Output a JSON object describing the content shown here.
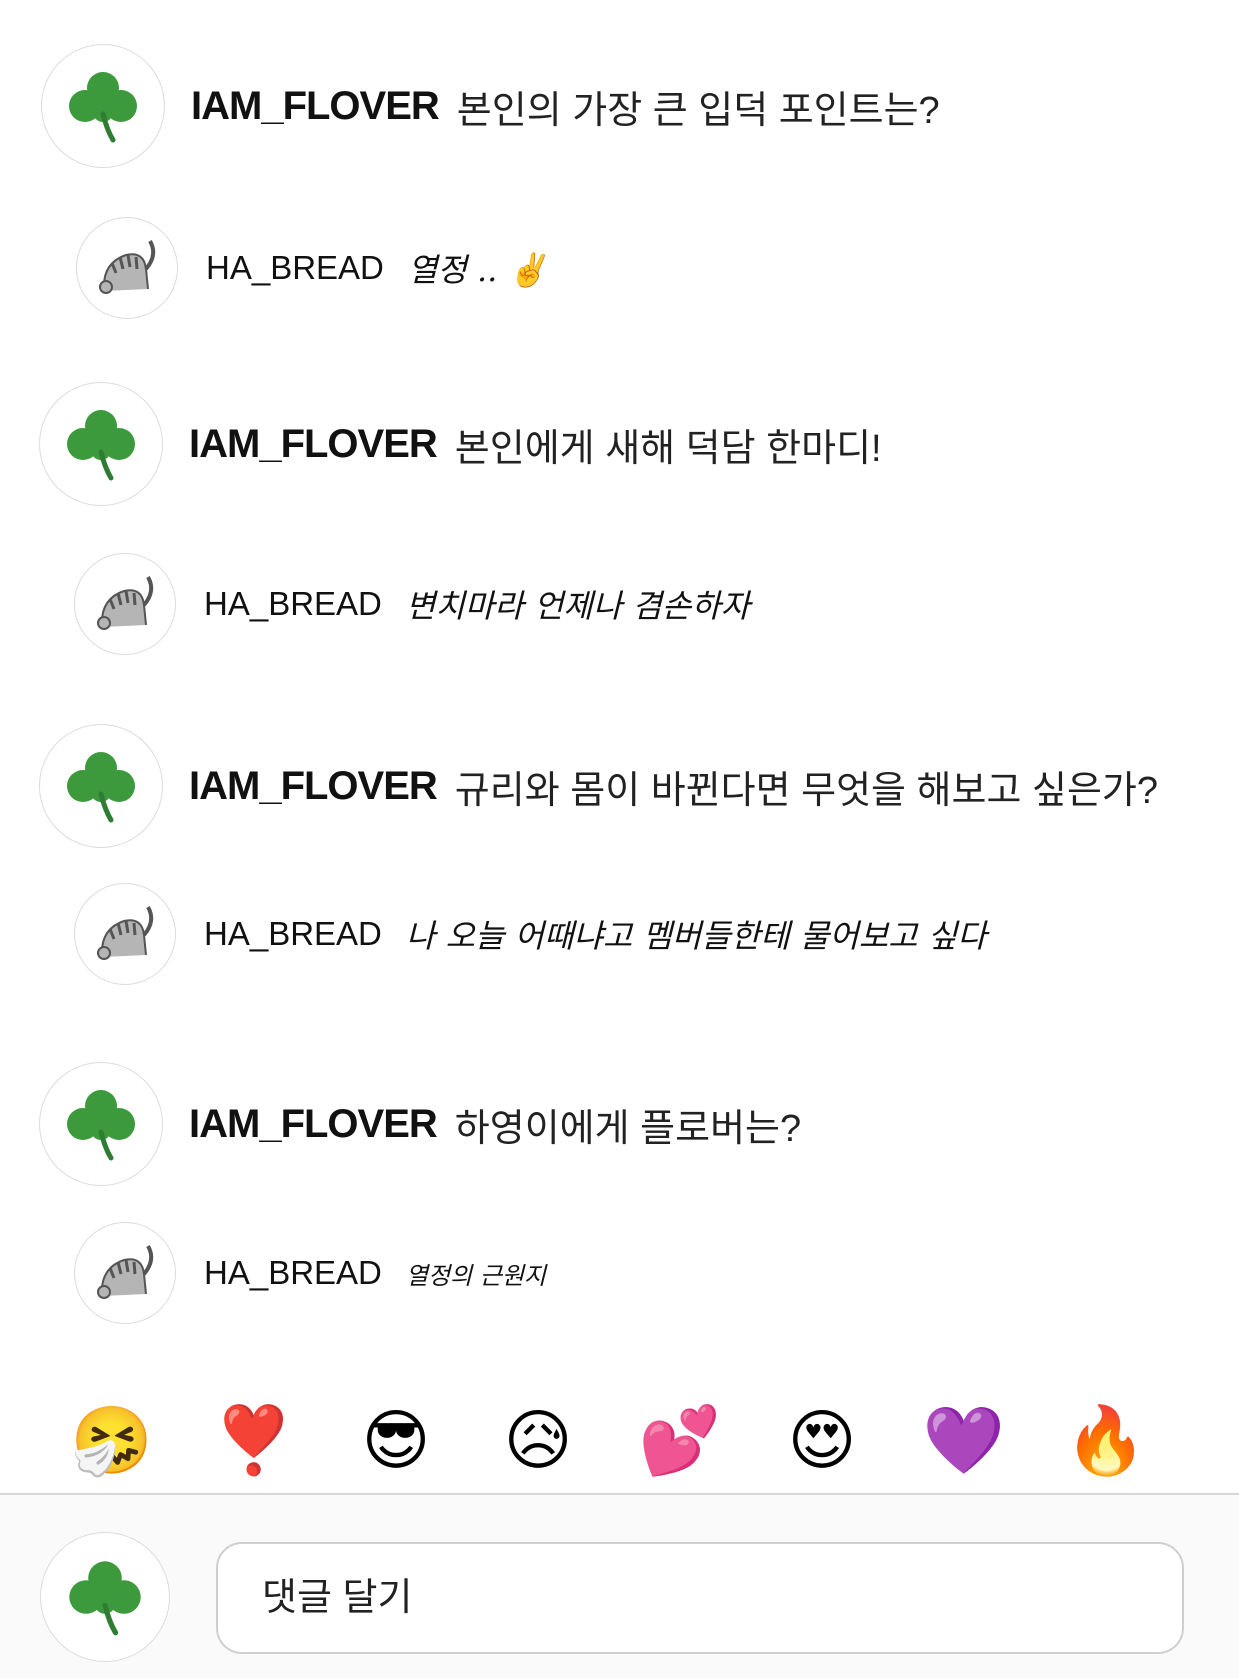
{
  "thread": [
    {
      "kind": "question",
      "username": "IAM_FLOVER",
      "text": "본인의 가장 큰 입덕 포인트는?",
      "avatar": "clover-icon"
    },
    {
      "kind": "answer",
      "username": "HA_BREAD",
      "text": "열정 .. ✌",
      "avatar": "cat-icon"
    },
    {
      "kind": "question",
      "username": "IAM_FLOVER",
      "text": "본인에게 새해 덕담 한마디!",
      "avatar": "clover-icon"
    },
    {
      "kind": "answer",
      "username": "HA_BREAD",
      "text": "변치마라 언제나 겸손하자",
      "avatar": "cat-icon"
    },
    {
      "kind": "question",
      "username": "IAM_FLOVER",
      "text": "규리와 몸이 바뀐다면 무엇을 해보고 싶은가?",
      "avatar": "clover-icon"
    },
    {
      "kind": "answer",
      "username": "HA_BREAD",
      "text": "나 오늘 어때냐고 멤버들한테 물어보고 싶다",
      "avatar": "cat-icon"
    },
    {
      "kind": "question",
      "username": "IAM_FLOVER",
      "text": "하영이에게 플로버는?",
      "avatar": "clover-icon"
    },
    {
      "kind": "answer",
      "username": "HA_BREAD",
      "text": "열정의 근원지",
      "avatar": "cat-icon"
    }
  ],
  "reactions": [
    {
      "name": "sneezing-face",
      "glyph": "🤧"
    },
    {
      "name": "heart-exclamation",
      "glyph": "❣️"
    },
    {
      "name": "sunglasses-face",
      "glyph": "😎"
    },
    {
      "name": "sad-sweat-face",
      "glyph": "😥"
    },
    {
      "name": "two-hearts",
      "glyph": "💕"
    },
    {
      "name": "heart-eyes-face",
      "glyph": "😍"
    },
    {
      "name": "purple-heart",
      "glyph": "💜"
    },
    {
      "name": "fire",
      "glyph": "🔥"
    }
  ],
  "compose": {
    "placeholder": "댓글 달기",
    "avatar": "clover-icon"
  },
  "colors": {
    "clover": "#3c9a3c",
    "clover_dark": "#2e7d32",
    "cat_gray": "#9a9a9a",
    "border": "#d6d6d6"
  }
}
